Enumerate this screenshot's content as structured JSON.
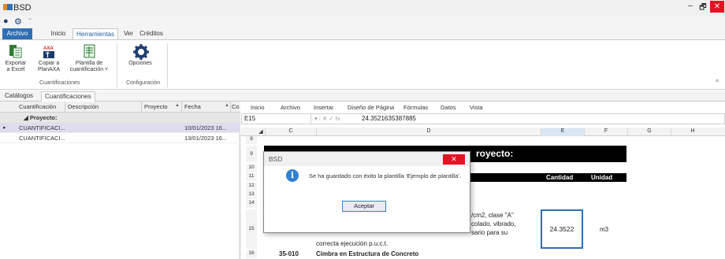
{
  "window": {
    "title": "BSD",
    "app_icon": "app-logo-icon",
    "minimize": "–",
    "maximize": "🗗",
    "close": "✕"
  },
  "quick_access": {
    "circle_icon": "●",
    "gear_icon": "⚙",
    "dropdown": "⁼"
  },
  "ribbon_tabs": [
    "Archivo",
    "Inicio",
    "Herramientas",
    "Ver",
    "Créditos"
  ],
  "ribbon": {
    "buttons": [
      {
        "label": "Exportar\na Excel",
        "icon": "excel-export-icon"
      },
      {
        "label": "Copiar a\nPlanAXA",
        "icon": "planaxa-copy-icon"
      },
      {
        "label": "Plantilla de\ncuantificación ˅",
        "icon": "template-icon"
      },
      {
        "label": "Opciones",
        "icon": "gear-icon"
      }
    ],
    "groups": [
      "Cuantificaciones",
      "Configuración"
    ],
    "collapse": "^"
  },
  "outer_tabs": [
    "Catálogos",
    "Cuantificaciones"
  ],
  "grid": {
    "columns": [
      "Cuantificación",
      "Descripción",
      "Proyecto",
      "Fecha",
      "Co"
    ],
    "sort_markers": [
      "▲",
      "▲"
    ],
    "group_label": "◢ Proyecto:",
    "rows": [
      {
        "name": "CUANTIFICACI...",
        "date": "10/01/2023 16...",
        "expander": "▸"
      },
      {
        "name": "CUANTIFICACI...",
        "date": "13/01/2023 16...",
        "expander": ""
      }
    ]
  },
  "excel": {
    "menu": [
      "Inicio",
      "Archivo",
      "Insertar",
      "Diseño de Página",
      "Fórmulas",
      "Datos",
      "Vista"
    ],
    "name_box": "E15",
    "fx_ops": "▾ ⁞ ✕ ✓ fx",
    "formula_value": "24.3521635387885",
    "col_headers": [
      "C",
      "D",
      "E",
      "F",
      "G",
      "H"
    ],
    "row_numbers": [
      "8",
      "9",
      "10",
      "11",
      "12",
      "13",
      "14",
      "15",
      "16"
    ],
    "header_text": "royecto:",
    "col_cantidad": "Cantidad",
    "col_unidad": "Unidad",
    "desc_line1": "/cm2, clase \"A\"",
    "desc_line2": "colado, vibrado,",
    "desc_line3": "sario para su",
    "desc_line4": "correcta ejecución p.u.c.t.",
    "value_e15": "24.3522",
    "unit_f15": "m3",
    "code_16": "35-010",
    "desc_16": "Cimbra en Estructura de Concreto"
  },
  "dialog": {
    "title": "BSD",
    "close": "✕",
    "icon": "i",
    "message": "Se ha guardado con éxito la plantilla 'Ejemplo de plantilla'.",
    "ok": "Aceptar"
  }
}
